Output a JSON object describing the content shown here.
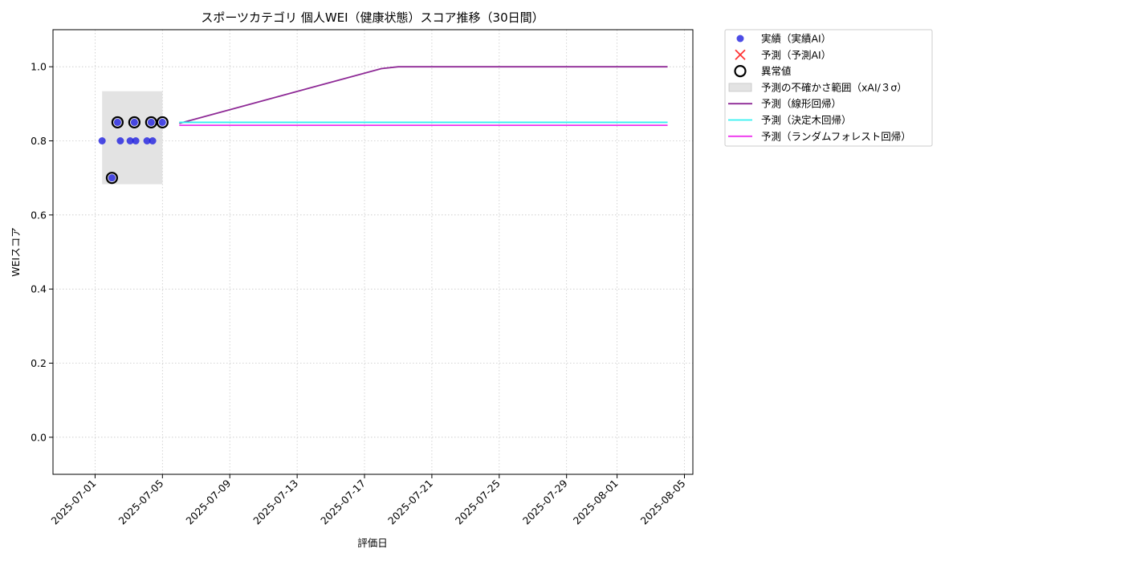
{
  "chart_data": {
    "type": "line",
    "title": "スポーツカテゴリ 個人WEI（健康状態）スコア推移（30日間）",
    "xlabel": "評価日",
    "ylabel": "WEIスコア",
    "xlim": [
      "2025-06-28T12:00",
      "2025-08-05T12:00"
    ],
    "ylim": [
      -0.1,
      1.1
    ],
    "x_ticks": [
      "2025-07-01",
      "2025-07-05",
      "2025-07-09",
      "2025-07-13",
      "2025-07-17",
      "2025-07-21",
      "2025-07-25",
      "2025-07-29",
      "2025-08-01",
      "2025-08-05"
    ],
    "y_ticks": [
      0.0,
      0.2,
      0.4,
      0.6,
      0.8,
      1.0
    ],
    "y_tick_labels": [
      "0.0",
      "0.2",
      "0.4",
      "0.6",
      "0.8",
      "1.0"
    ],
    "grid": true,
    "legend_position": "outside-top-right",
    "series": [
      {
        "name": "実績（実績AI）",
        "kind": "scatter",
        "color": "#1f1fe0",
        "points": [
          {
            "x": "2025-07-01T10:00",
            "y": 0.8
          },
          {
            "x": "2025-07-02T00:00",
            "y": 0.7
          },
          {
            "x": "2025-07-02T08:00",
            "y": 0.85
          },
          {
            "x": "2025-07-02T12:00",
            "y": 0.8
          },
          {
            "x": "2025-07-03T02:00",
            "y": 0.8
          },
          {
            "x": "2025-07-03T08:00",
            "y": 0.85
          },
          {
            "x": "2025-07-03T10:00",
            "y": 0.8
          },
          {
            "x": "2025-07-04T02:00",
            "y": 0.8
          },
          {
            "x": "2025-07-04T08:00",
            "y": 0.85
          },
          {
            "x": "2025-07-04T10:00",
            "y": 0.8
          },
          {
            "x": "2025-07-05T00:00",
            "y": 0.85
          }
        ]
      },
      {
        "name": "予測（予測AI）",
        "kind": "scatter-x",
        "color": "#ff3333",
        "points": []
      },
      {
        "name": "異常値",
        "kind": "ring",
        "color": "#000000",
        "points": [
          {
            "x": "2025-07-02T00:00",
            "y": 0.7
          },
          {
            "x": "2025-07-02T08:00",
            "y": 0.85
          },
          {
            "x": "2025-07-03T08:00",
            "y": 0.85
          },
          {
            "x": "2025-07-04T08:00",
            "y": 0.85
          },
          {
            "x": "2025-07-05T00:00",
            "y": 0.85
          }
        ]
      },
      {
        "name": "予測の不確かさ範囲（xAI/３σ）",
        "kind": "band",
        "color": "#d9d9d9",
        "x_start": "2025-07-01T10:00",
        "x_end": "2025-07-05T00:00",
        "y_low": 0.683,
        "y_high": 0.934
      },
      {
        "name": "予測（線形回帰）",
        "kind": "line",
        "color": "#8e2a96",
        "points": [
          {
            "x": "2025-07-06T00:00",
            "y": 0.847
          },
          {
            "x": "2025-07-18T00:00",
            "y": 0.995
          },
          {
            "x": "2025-07-19T00:00",
            "y": 1.0
          },
          {
            "x": "2025-08-04T00:00",
            "y": 1.0
          }
        ]
      },
      {
        "name": "予測（決定木回帰）",
        "kind": "line",
        "color": "#33f0f0",
        "points": [
          {
            "x": "2025-07-06T00:00",
            "y": 0.85
          },
          {
            "x": "2025-08-04T00:00",
            "y": 0.85
          }
        ]
      },
      {
        "name": "予測（ランダムフォレスト回帰）",
        "kind": "line",
        "color": "#ee33ee",
        "points": [
          {
            "x": "2025-07-06T00:00",
            "y": 0.842
          },
          {
            "x": "2025-08-04T00:00",
            "y": 0.842
          }
        ]
      }
    ]
  }
}
